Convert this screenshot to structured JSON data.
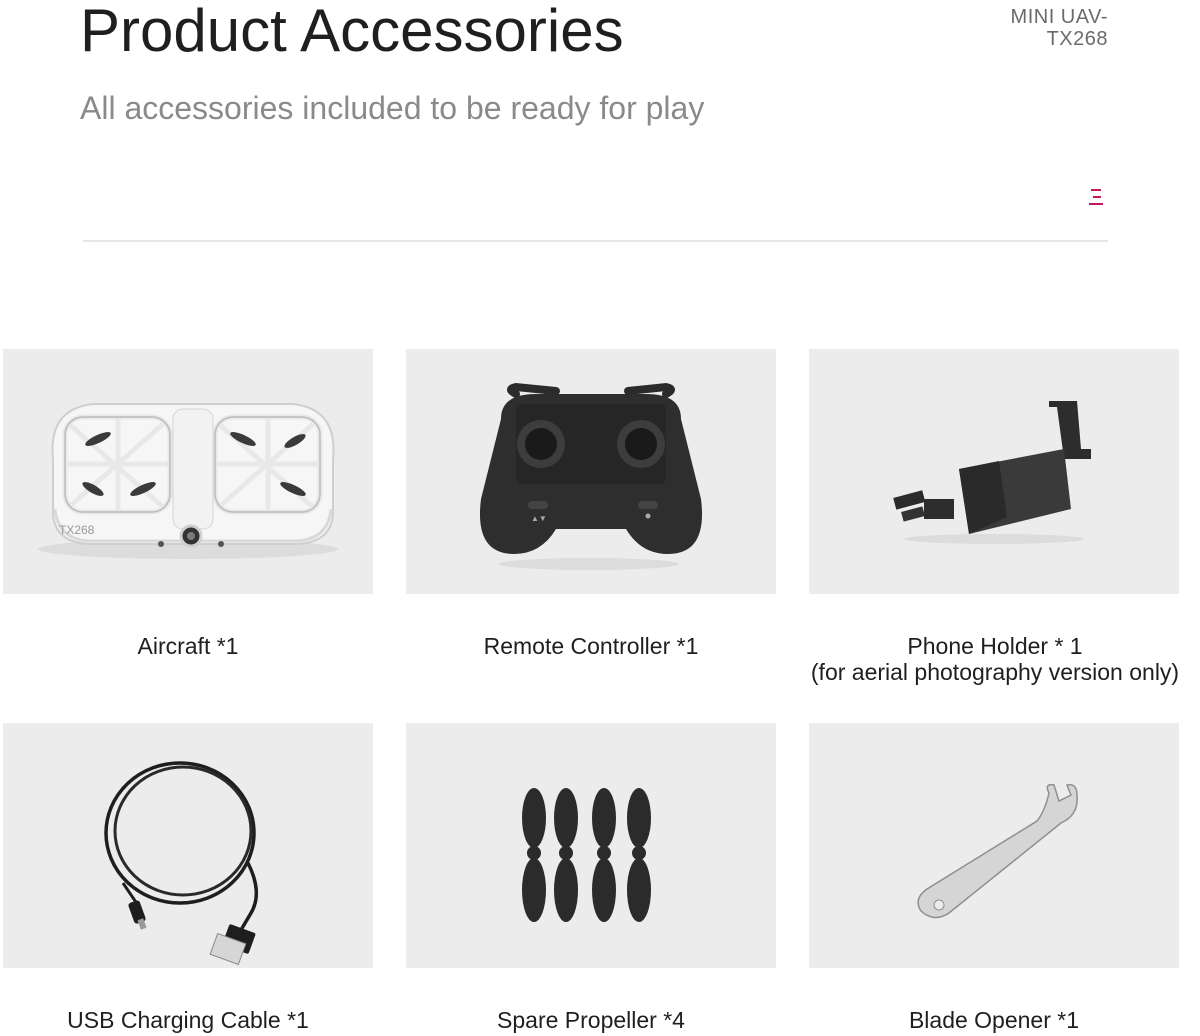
{
  "header": {
    "title": "Product Accessories",
    "brand_line1": "MINI UAV-",
    "brand_line2": "TX268",
    "subtitle": "All accessories included to be ready for play",
    "menu_icon": "menu-icon",
    "accent_color": "#c2185b"
  },
  "items": [
    {
      "label": "Aircraft *1",
      "note": "",
      "icon": "drone-image",
      "model": "TX268"
    },
    {
      "label": "Remote Controller *1",
      "note": "",
      "icon": "remote-controller-image"
    },
    {
      "label": "Phone Holder * 1",
      "note": "(for aerial photography version only)",
      "icon": "phone-holder-image"
    },
    {
      "label": "USB Charging Cable *1",
      "note": "",
      "icon": "usb-cable-image"
    },
    {
      "label": "Spare Propeller *4",
      "note": "",
      "icon": "propeller-image"
    },
    {
      "label": "Blade Opener *1",
      "note": "",
      "icon": "blade-opener-image"
    }
  ],
  "colors": {
    "card_bg": "#ececec",
    "dark_product": "#2b2b2b",
    "white_product": "#f4f4f4"
  }
}
